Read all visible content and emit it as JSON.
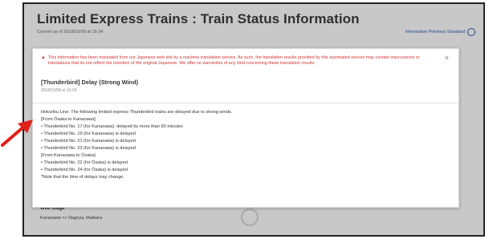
{
  "page": {
    "title": "Limited Express Trains : Train Status Information",
    "subtitle": "Current as of  2018/10/09 at 15:34",
    "link_label": "Information Previous Standard",
    "bottom_title": "Wild Stage",
    "bottom_subtitle": "Kanazawa <> Nagoya, Maibara"
  },
  "modal": {
    "warning": "This information has been translated from our Japanese web site by a machine translation service. As such, the translation results provided by this automated service may contain inaccuracies or translations that do not reflect the intention of the original Japanese. We offer no warranties of any kind concerning these translation results.",
    "close_label": "×",
    "status_title": "[Thunderbird]  Delay (Strong Wind)",
    "status_time": "2018/10/09 at 15:29",
    "body_lines": [
      "Hokuriku Line: The following limited express Thunderbird trains are delayed due to strong winds.",
      "[From Ōsaka to Kanazawa]",
      "• Thunderbird No. 17 (for Kanazawa): delayed by more than 60 minutes",
      "• Thunderbird No. 19 (for Kanazawa) is delayed",
      "• Thunderbird No. 21 (for Kanazawa) is delayed",
      "• Thunderbird No. 23 (for Kanazawa) is delayed",
      "[From Kanazawa to Ōsaka]",
      "• Thunderbird No. 22 (for Ōsaka) is delayed",
      "• Thunderbird No. 24 (for Ōsaka) is delayed",
      "*Note that the time of delays may change."
    ]
  },
  "colors": {
    "warning_red": "#d03434",
    "arrow_red": "#e0201b",
    "link_blue": "#2a5aa8"
  },
  "icons": {
    "warning": "warning-triangle-icon",
    "close": "close-icon",
    "arrow": "red-arrow-icon",
    "info": "circle-info-icon"
  }
}
